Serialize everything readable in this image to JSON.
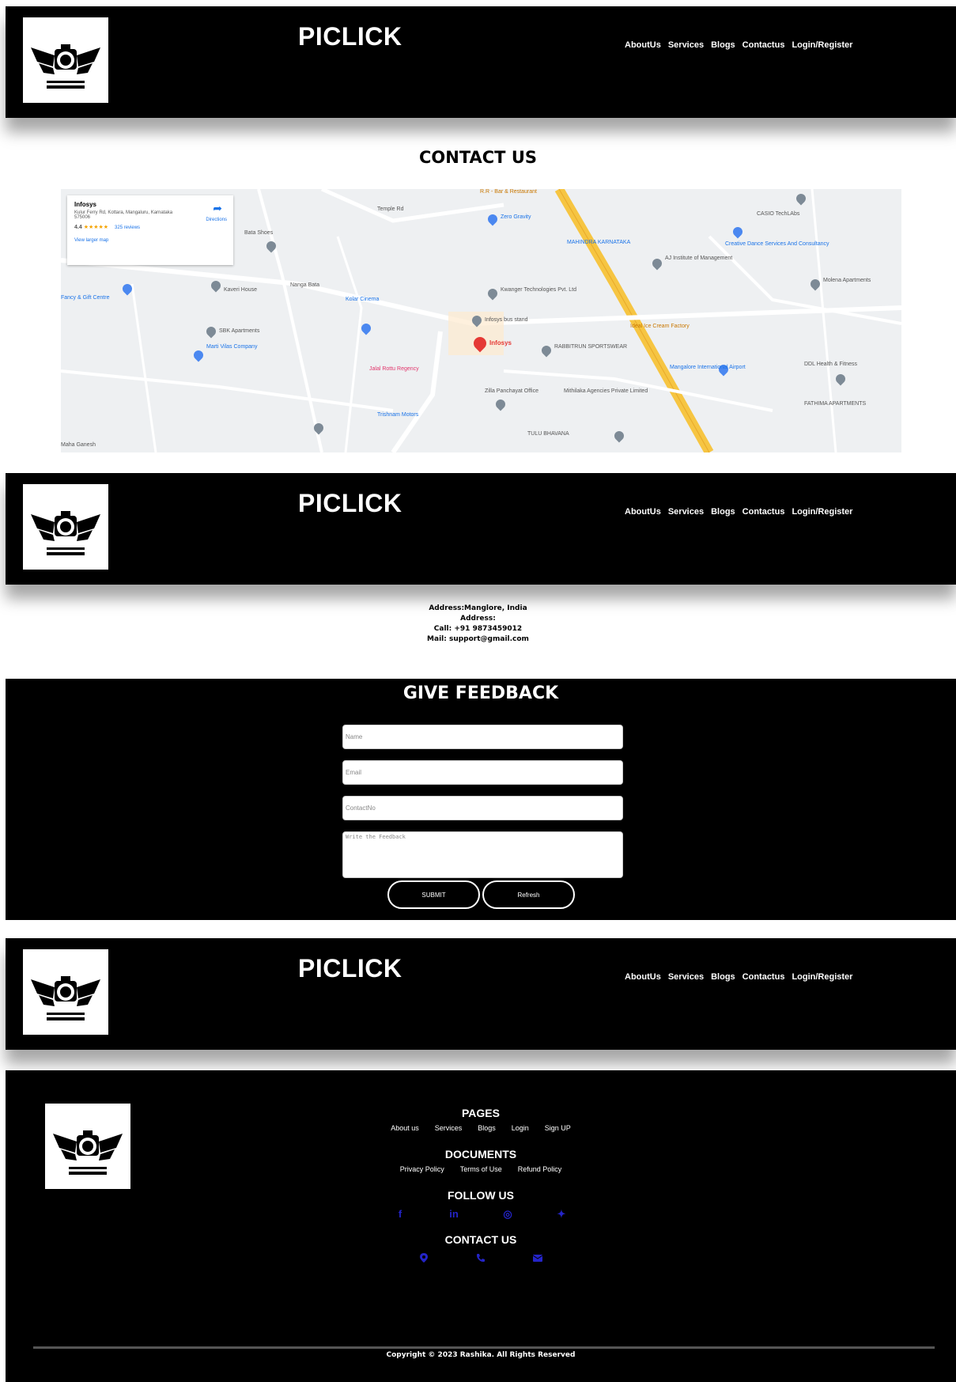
{
  "navbar": {
    "brand": "PICLICK",
    "logo_icon": "camera-wings-logo-icon",
    "links": [
      "AboutUs",
      "Services",
      "Blogs",
      "Contactus",
      "Login/Register"
    ]
  },
  "contact_section": {
    "title": "CONTACT US"
  },
  "map": {
    "place_name": "Infosys",
    "place_address": "Kulur Ferry Rd, Kottara, Mangaluru, Karnataka 575006",
    "rating": "4.4",
    "stars": "★★★★★",
    "reviews": "325 reviews",
    "view_larger": "View larger map",
    "directions": "Directions",
    "pin_label": "Infosys",
    "labels": {
      "temple_rd": "Temple Rd",
      "bar_restaurant": "R.R - Bar & Restaurant",
      "zero_gravity": "Zero Gravity",
      "bata": "Bata Shoes",
      "mahindra": "MAHINDRA KARNATAKA",
      "aj_institute": "AJ Institute of Management",
      "creative_dance": "Creative Dance Services And Consultancy",
      "casio": "CASIO TechLAbs",
      "fancy": "Fancy & Gift Centre",
      "kavery": "Kaveri House",
      "nanga": "Nanga Bata",
      "kwanger": "Kwanger Technologies Pvt. Ltd",
      "infosys_bus": "Infosys bus stand",
      "molena": "Molena Apartments",
      "sbk": "SBK Apartments",
      "marti": "Marti Vilas Company",
      "kolar": "Kolar Cinema",
      "ice_cream": "Ideal Ice Cream Factory",
      "rabbitrun": "RABBITRUN SPORTSWEAR",
      "mangalore_airport": "Mangalore International Airport",
      "sugandhi": "Jalal Rottu Regency",
      "ddl": "DDL Health & Fitness",
      "panchayat": "Zilla Panchayat Office",
      "mithilaka": "Mithilaka Agencies Private Limited",
      "tulu": "TULU BHAVANA",
      "trishnam": "Trishnam Motors",
      "fathima": "FATHIMA APARTMENTS",
      "maha": "Maha Ganesh"
    }
  },
  "address_block": {
    "address_line": "Address:Manglore, India",
    "address_label": "Address:",
    "call": "Call: +91 9873459012",
    "mail": "Mail: support@gmail.com"
  },
  "feedback": {
    "title": "GIVE FEEDBACK",
    "name_placeholder": "Name",
    "email_placeholder": "Email",
    "contact_placeholder": "ContactNo",
    "message_placeholder": "Write the Feedback",
    "submit_label": "SUBMIT",
    "refresh_label": "Refresh"
  },
  "footer": {
    "pages_heading": "PAGES",
    "pages": [
      "About us",
      "Services",
      "Blogs",
      "Login",
      "Sign UP"
    ],
    "documents_heading": "DOCUMENTS",
    "documents": [
      "Privacy Policy",
      "Terms of Use",
      "Refund Policy"
    ],
    "follow_heading": "FOLLOW US",
    "social_icons": [
      "facebook-icon",
      "linkedin-icon",
      "instagram-icon",
      "twitter-icon"
    ],
    "social_glyphs": [
      "f",
      "in",
      "◎",
      "✦"
    ],
    "contact_heading": "CONTACT US",
    "contact_icons": [
      "location-icon",
      "phone-icon",
      "mail-icon"
    ],
    "icon_color": "#2424c8",
    "copyright": "Copyright © 2023 Rashika. All Rights Reserved"
  }
}
